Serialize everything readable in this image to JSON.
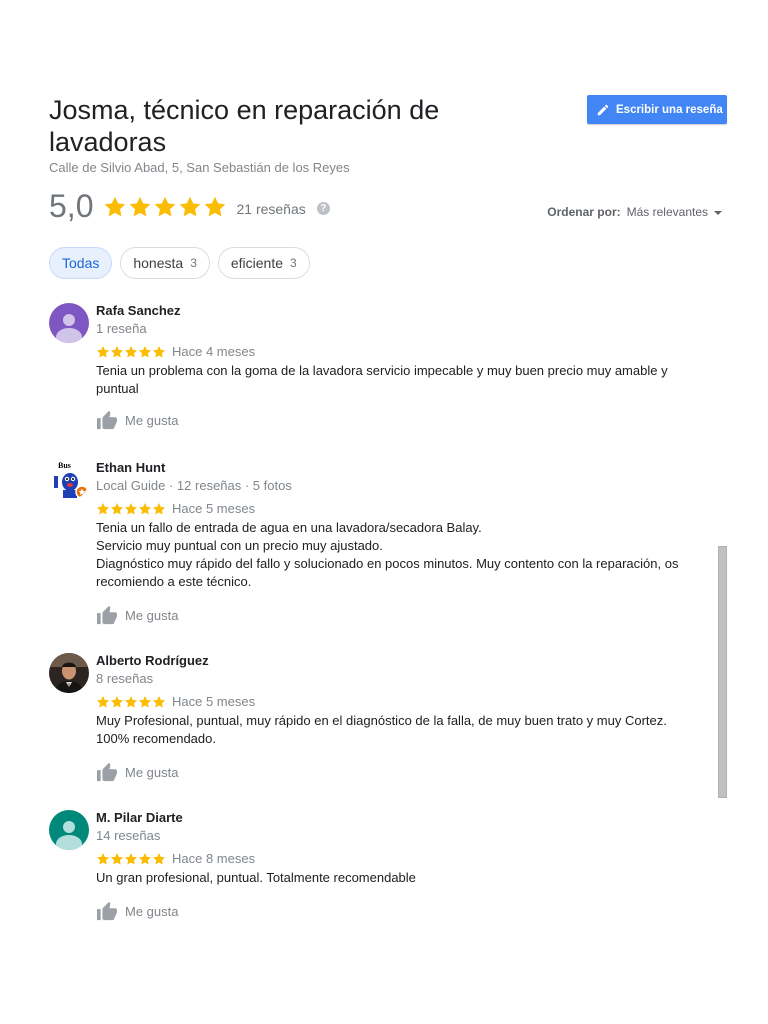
{
  "place": {
    "title": "Josma, técnico en reparación de lavadoras",
    "address": "Calle de Silvio Abad, 5, San Sebastián de los Reyes"
  },
  "write_button": {
    "label": "Escribir una reseña",
    "icon": "pencil-icon"
  },
  "summary": {
    "rating": "5,0",
    "stars": 5,
    "count_label": "21 reseñas",
    "help_icon": "?"
  },
  "sort": {
    "label": "Ordenar por:",
    "value": "Más relevantes"
  },
  "chips": [
    {
      "label": "Todas",
      "count": ""
    },
    {
      "label": "honesta",
      "count": "3"
    },
    {
      "label": "eficiente",
      "count": "3"
    }
  ],
  "colors": {
    "accent": "#4285f4",
    "star": "#fbbc04",
    "muted": "#80868b"
  },
  "like_label": "Me gusta",
  "reviews": [
    {
      "name": "Rafa Sanchez",
      "meta": "1 reseña",
      "stars": 5,
      "ago": "Hace 4 meses",
      "text": "Tenia un problema con la goma de la lavadora servicio impecable y muy buen precio muy amable y puntual",
      "avatar": "purple-default-avatar"
    },
    {
      "name": "Ethan Hunt",
      "meta": "Local Guide · 12 reseñas · 5 fotos",
      "stars": 5,
      "ago": "Hace 5 meses",
      "text": "Tenia un fallo de entrada de agua en una lavadora/secadora Balay.\nServicio muy puntual con un precio muy ajustado.\nDiagnóstico muy rápido del fallo y solucionado en pocos minutos.  Muy contento con la reparación, os recomiendo a este técnico.",
      "avatar": "cartoon-avatar",
      "avatar_text": "Bus"
    },
    {
      "name": "Alberto Rodríguez",
      "meta": "8 reseñas",
      "stars": 5,
      "ago": "Hace 5 meses",
      "text": "Muy Profesional, puntual, muy rápido en el diagnóstico de la falla, de muy buen trato y muy Cortez.\n100% recomendado.",
      "avatar": "photo-avatar"
    },
    {
      "name": "M. Pilar Diarte",
      "meta": "14 reseñas",
      "stars": 5,
      "ago": "Hace 8 meses",
      "text": "Un gran profesional, puntual. Totalmente recomendable",
      "avatar": "teal-default-avatar"
    }
  ]
}
